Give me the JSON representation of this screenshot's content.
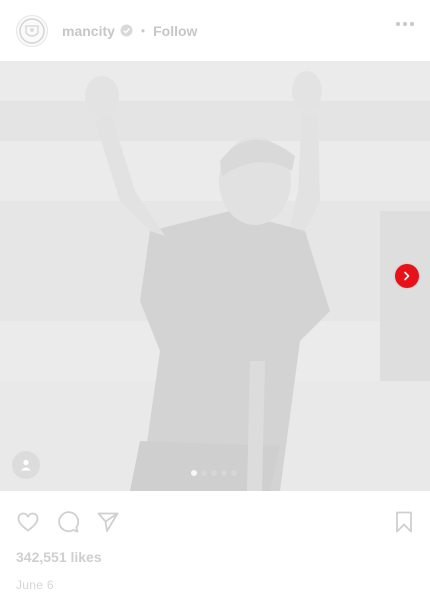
{
  "header": {
    "username": "mancity",
    "separator": "•",
    "follow_label": "Follow"
  },
  "post": {
    "carousel_count": 5,
    "active_index": 0
  },
  "footer": {
    "likes_text": "342,551 likes",
    "date_text": "June 6"
  },
  "colors": {
    "accent_red": "#e8111a",
    "muted_text": "#c7c7c7"
  },
  "icons": {
    "avatar": "club-crest-icon",
    "verified": "verified-badge-icon",
    "more": "more-options-icon",
    "next": "chevron-right-icon",
    "tag": "user-tag-icon",
    "like": "heart-icon",
    "comment": "comment-icon",
    "share": "share-icon",
    "save": "bookmark-icon"
  }
}
